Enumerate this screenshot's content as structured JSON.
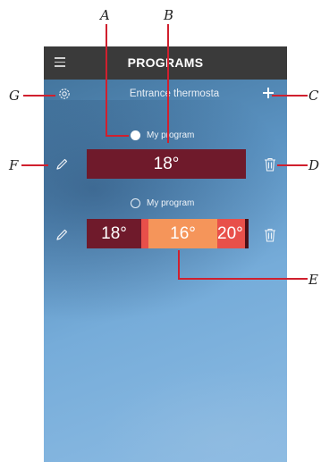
{
  "header": {
    "title": "PROGRAMS"
  },
  "device": {
    "name": "Entrance thermosta"
  },
  "programs": [
    {
      "name": "My program",
      "selected": true,
      "segments": [
        "18°"
      ]
    },
    {
      "name": "My program",
      "selected": false,
      "segments": [
        "18°",
        "16°",
        "20°"
      ]
    }
  ],
  "annotations": {
    "A": "A",
    "B": "B",
    "C": "C",
    "D": "D",
    "E": "E",
    "F": "F",
    "G": "G"
  },
  "colors": {
    "topbar": "#3a3a3a",
    "dark_red": "#6f1a2b",
    "orange": "#f5955a",
    "red": "#e8504a",
    "annotation": "#d0202e"
  }
}
